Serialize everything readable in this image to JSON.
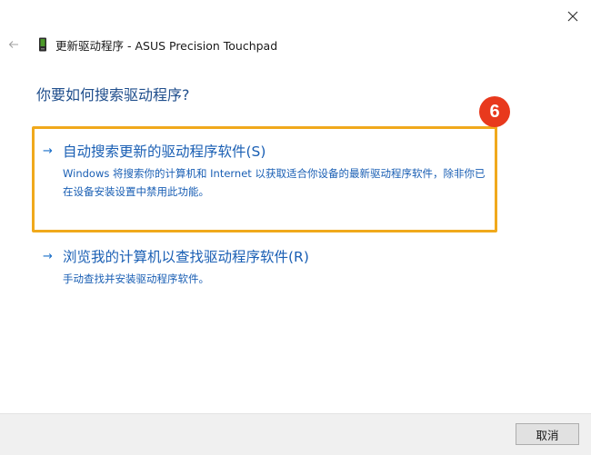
{
  "window": {
    "title": "更新驱动程序 - ASUS Precision Touchpad"
  },
  "icons": {
    "close": "close-icon",
    "back": "back-arrow-icon",
    "device": "device-icon",
    "option_arrow": "right-arrow-icon"
  },
  "main": {
    "heading": "你要如何搜索驱动程序?"
  },
  "annotation": {
    "step_number": "6",
    "highlight_color": "#f0a91c",
    "badge_color": "#e8391d"
  },
  "options": [
    {
      "title": "自动搜索更新的驱动程序软件(S)",
      "description": "Windows 将搜索你的计算机和 Internet 以获取适合你设备的最新驱动程序软件，除非你已在设备安装设置中禁用此功能。"
    },
    {
      "title": "浏览我的计算机以查找驱动程序软件(R)",
      "description": "手动查找并安装驱动程序软件。"
    }
  ],
  "footer": {
    "cancel_label": "取消"
  },
  "colors": {
    "link": "#1a5fb4",
    "heading": "#1f4e8c",
    "footer_bg": "#f0f0f0"
  }
}
